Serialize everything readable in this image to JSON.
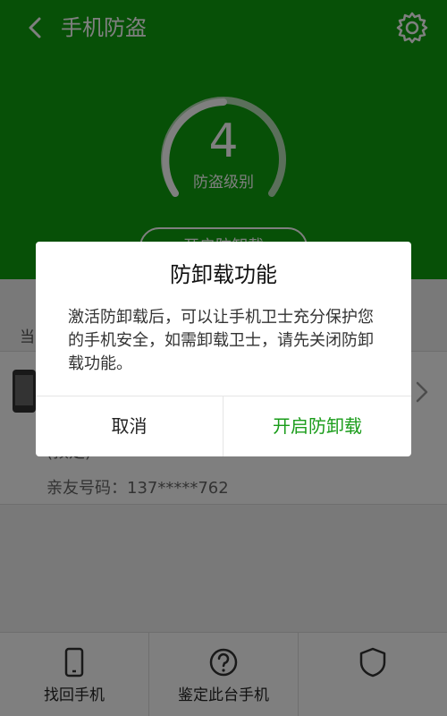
{
  "header": {
    "title": "手机防盗",
    "back_icon": "chevron-left-icon",
    "settings_icon": "gear-icon"
  },
  "protection": {
    "level": "4",
    "level_label": "防盗级别",
    "action_button_label": "开启防卸载"
  },
  "section": {
    "label": "当"
  },
  "info_card": {
    "line1": "(预定)",
    "contact_label": "亲友号码：137*****762"
  },
  "tabs": [
    {
      "label": "找回手机",
      "icon": "phone-icon"
    },
    {
      "label": "鉴定此台手机",
      "icon": "question-icon"
    },
    {
      "label": "",
      "icon": "shield-icon"
    }
  ],
  "dialog": {
    "title": "防卸载功能",
    "message": "激活防卸载后，可以让手机卫士充分保护您的手机安全，如需卸载卫士，请先关闭防卸载功能。",
    "cancel_label": "取消",
    "confirm_label": "开启防卸载"
  },
  "colors": {
    "brand_green": "#0ea10e",
    "confirm_green": "#1a9c1a"
  }
}
